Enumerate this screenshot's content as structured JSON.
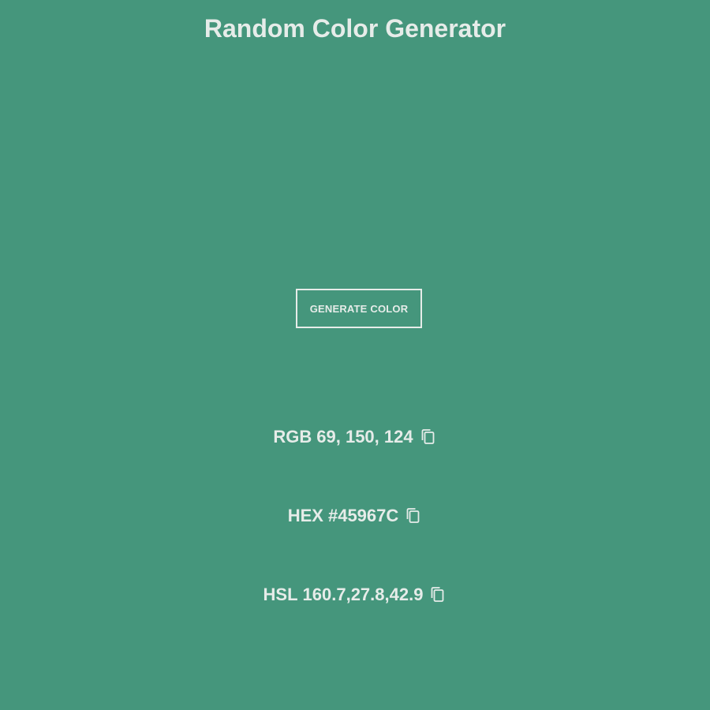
{
  "header": {
    "title": "Random Color Generator"
  },
  "controls": {
    "generate_label": "GENERATE COLOR"
  },
  "values": {
    "rgb": {
      "label": "RGB",
      "value": "69, 150, 124"
    },
    "hex": {
      "label": "HEX",
      "value": "#45967C"
    },
    "hsl": {
      "label": "HSL",
      "value": "160.7,27.8,42.9"
    }
  },
  "icons": {
    "copy": "copy-icon"
  },
  "colors": {
    "background": "#45967C",
    "foreground": "#E6ECE9"
  }
}
